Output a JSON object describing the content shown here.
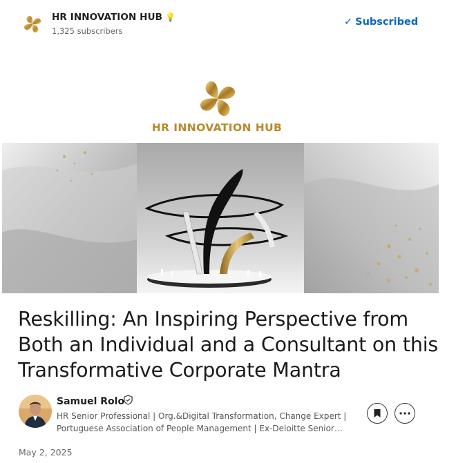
{
  "newsletter": {
    "title": "HR INNOVATION HUB",
    "title_emoji": "💡",
    "subscribers": "1,325 subscribers",
    "subscribe_state": "Subscribed"
  },
  "banner": {
    "brand_text": "HR INNOVATION HUB"
  },
  "article": {
    "title": "Reskilling: An Inspiring Perspective from Both an Individual and a Consultant on this Transformative Corporate Mantra",
    "date": "May 2, 2025"
  },
  "author": {
    "name": "Samuel Rolo",
    "headline": "HR Senior Professional | Org.&Digital Transformation, Change Expert | Portuguese Association of People Management | Ex-Deloitte Senior…"
  },
  "colors": {
    "link_blue": "#0a66c2",
    "gold": "#b98a2d"
  },
  "icons": [
    "newsletter-logo-icon",
    "verified-badge-icon",
    "bookmark-icon",
    "more-options-icon",
    "checkmark-icon"
  ]
}
